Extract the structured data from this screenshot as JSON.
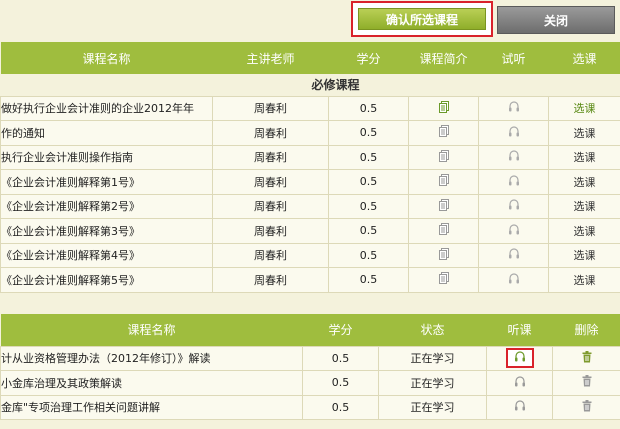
{
  "top": {
    "confirm_label": "确认所选课程",
    "close_label": "关闭"
  },
  "table1": {
    "headers": [
      "课程名称",
      "主讲老师",
      "学分",
      "课程简介",
      "试听",
      "选课"
    ],
    "section_label": "必修课程",
    "rows": [
      {
        "name": "做好执行企业会计准则的企业2012年年",
        "teacher": "周春利",
        "credit": "0.5",
        "select": "选课"
      },
      {
        "name": "作的通知",
        "teacher": "周春利",
        "credit": "0.5",
        "select": "选课"
      },
      {
        "name": "执行企业会计准则操作指南",
        "teacher": "周春利",
        "credit": "0.5",
        "select": "选课"
      },
      {
        "name": "《企业会计准则解释第1号》",
        "teacher": "周春利",
        "credit": "0.5",
        "select": "选课"
      },
      {
        "name": "《企业会计准则解释第2号》",
        "teacher": "周春利",
        "credit": "0.5",
        "select": "选课"
      },
      {
        "name": "《企业会计准则解释第3号》",
        "teacher": "周春利",
        "credit": "0.5",
        "select": "选课"
      },
      {
        "name": "《企业会计准则解释第4号》",
        "teacher": "周春利",
        "credit": "0.5",
        "select": "选课"
      },
      {
        "name": "《企业会计准则解释第5号》",
        "teacher": "周春利",
        "credit": "0.5",
        "select": "选课"
      }
    ]
  },
  "table2": {
    "headers": [
      "课程名称",
      "学分",
      "状态",
      "听课",
      "删除"
    ],
    "rows": [
      {
        "name": "计从业资格管理办法（2012年修订）》解读",
        "credit": "0.5",
        "status": "正在学习"
      },
      {
        "name": "小金库治理及其政策解读",
        "credit": "0.5",
        "status": "正在学习"
      },
      {
        "name": "金库\"专项治理工作相关问题讲解",
        "credit": "0.5",
        "status": "正在学习"
      }
    ]
  },
  "colors": {
    "header_green": "#9fbd3e",
    "highlight_red": "#d9222a",
    "page_bg": "#f4f2dc"
  },
  "icons": {
    "intro": "document-copy-icon",
    "listen": "headphones-icon",
    "delete": "trash-icon"
  }
}
